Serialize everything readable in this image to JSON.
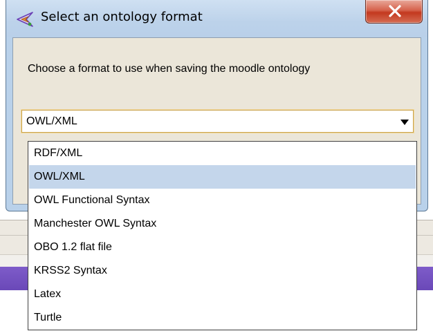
{
  "window": {
    "title": "Select an ontology format",
    "close_icon": "close-x-icon",
    "app_icon": "protege-logo-icon"
  },
  "dialog": {
    "prompt": "Choose a format to use when saving the moodle ontology"
  },
  "combo": {
    "selected_value": "OWL/XML",
    "arrow_icon": "chevron-down-icon"
  },
  "dropdown": {
    "options": [
      {
        "label": "RDF/XML",
        "selected": false
      },
      {
        "label": "OWL/XML",
        "selected": true
      },
      {
        "label": "OWL Functional Syntax",
        "selected": false
      },
      {
        "label": "Manchester OWL Syntax",
        "selected": false
      },
      {
        "label": "OBO 1.2 flat file",
        "selected": false
      },
      {
        "label": "KRSS2 Syntax",
        "selected": false
      },
      {
        "label": "Latex",
        "selected": false
      },
      {
        "label": "Turtle",
        "selected": false
      }
    ]
  },
  "colors": {
    "titlebar": "#b9d1ea",
    "client_bg": "#ebe6d9",
    "selection": "#c4d6eb",
    "close_button": "#c3391f",
    "combo_focus": "#c9a44f",
    "background_accent": "#6a48b8"
  }
}
